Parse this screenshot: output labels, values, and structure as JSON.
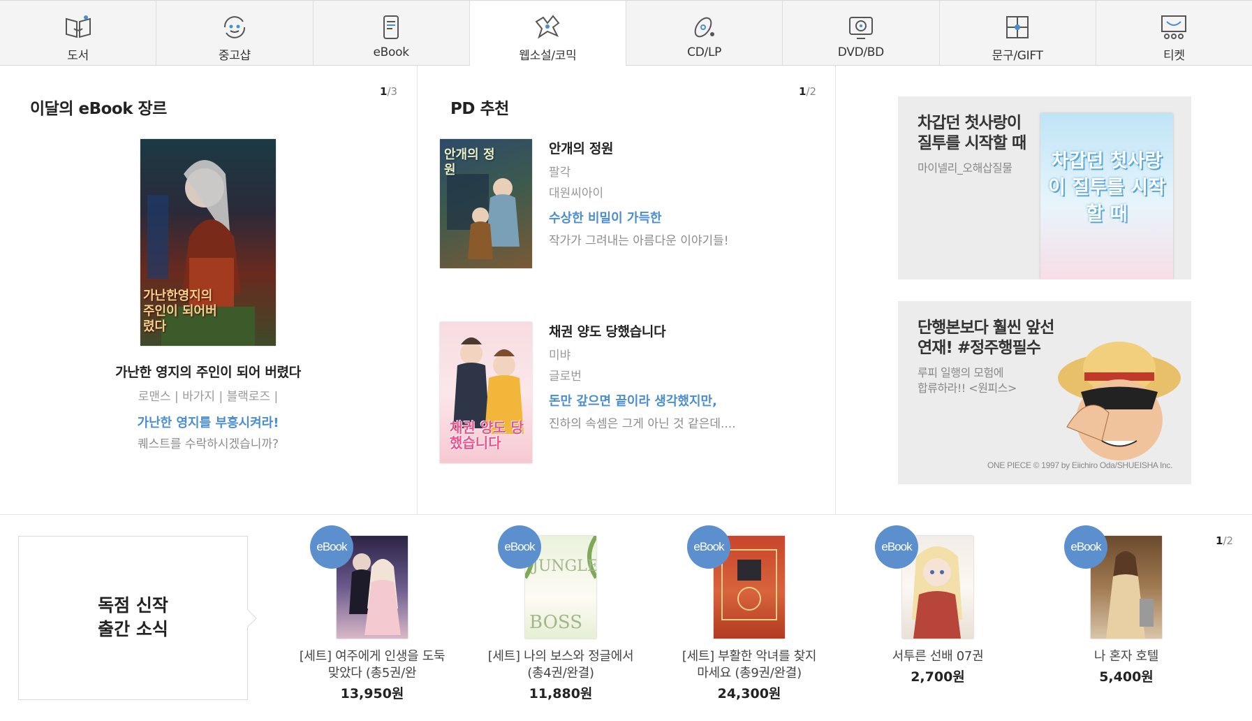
{
  "tabs": [
    {
      "label": "도서",
      "icon": "book-icon"
    },
    {
      "label": "중고샵",
      "icon": "recycle-smile-icon"
    },
    {
      "label": "eBook",
      "icon": "ebook-reader-icon"
    },
    {
      "label": "웹소설/코믹",
      "icon": "comic-icon",
      "active": true
    },
    {
      "label": "CD/LP",
      "icon": "music-disc-icon"
    },
    {
      "label": "DVD/BD",
      "icon": "dvd-icon"
    },
    {
      "label": "문구/GIFT",
      "icon": "gift-icon"
    },
    {
      "label": "티켓",
      "icon": "ticket-theater-icon"
    }
  ],
  "genre": {
    "title": "이달의 eBook 장르",
    "pager_current": "1",
    "pager_total": "/3",
    "book_title": "가난한 영지의 주인이 되어 버렸다",
    "tags": "로맨스 | 바가지 | 블랙로즈 |",
    "tagline": "가난한 영지를 부흥시켜라!",
    "desc": "퀘스트를 수락하시겠습니까?",
    "cover_text": "가난한영지의 주인이 되어버렸다"
  },
  "pd": {
    "title": "PD 추천",
    "pager_current": "1",
    "pager_total": "/2",
    "items": [
      {
        "title": "안개의 정원",
        "author": "팔각",
        "publisher": "대원씨아이",
        "tagline": "수상한 비밀이 가득한",
        "desc": "작가가 그려내는 아름다운 이야기들!",
        "cover_text": "안개의 정원"
      },
      {
        "title": "채권 양도 당했습니다",
        "author": "미뱌",
        "publisher": "글로번",
        "tagline": "돈만 갚으면 끝이라 생각했지만,",
        "desc": "진하의 속셈은 그게 아닌 것 같은데....",
        "cover_text": "채권 양도 당했습니다"
      }
    ]
  },
  "banners": [
    {
      "headline1": "차갑던 첫사랑이",
      "headline2": "질투를 시작할 때",
      "sub": "마이넬리_오해삽질물",
      "art_text": "차갑던 첫사랑이 질투를 시작할 때"
    },
    {
      "headline1": "단행본보다 훨씬 앞선",
      "headline2": "연재! #정주행필수",
      "sub1": "루피 일행의 모험에",
      "sub2": "합류하라!! <원피스>",
      "credit": "ONE PIECE © 1997 by Eiichiro Oda/SHUEISHA Inc."
    }
  ],
  "new_releases": {
    "notice_line1": "독점 신작",
    "notice_line2": "출간 소식",
    "pager_current": "1",
    "pager_total": "/2",
    "badge": "eBook",
    "items": [
      {
        "name": "[세트] 여주에게 인생을 도둑맞았다 (총5권/완",
        "price": "13,950원"
      },
      {
        "name": "[세트] 나의 보스와 정글에서 (총4권/완결)",
        "price": "11,880원"
      },
      {
        "name": "[세트] 부활한 악녀를 찾지 마세요 (총9권/완결)",
        "price": "24,300원"
      },
      {
        "name": "서투른 선배 07권",
        "price": "2,700원"
      },
      {
        "name": "나 혼자 호텔",
        "price": "5,400원"
      }
    ]
  },
  "colors": {
    "accent": "#4b8ed0",
    "badge": "#5b8fcd",
    "tab_bg": "#f4f4f4"
  }
}
